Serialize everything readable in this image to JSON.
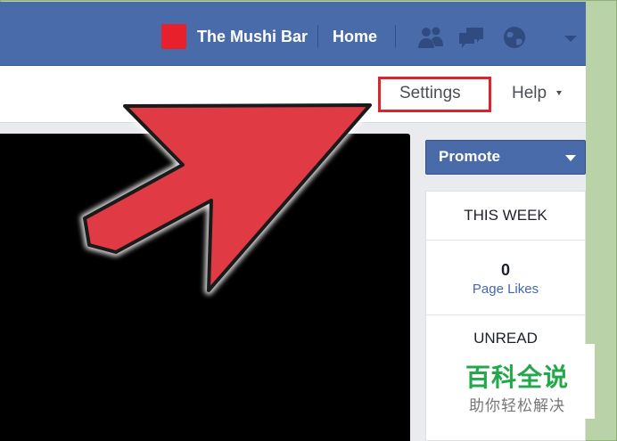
{
  "topbar": {
    "page_name": "The Mushi Bar",
    "home_label": "Home",
    "icons": [
      "friends-icon",
      "messages-icon",
      "globe-icon",
      "dropdown-caret-icon"
    ],
    "brand_color": "#4a6ba9"
  },
  "tabs": {
    "settings_label": "Settings",
    "help_label": "Help",
    "highlight_color": "#d9262e"
  },
  "sidebar": {
    "promote_label": "Promote",
    "this_week_title": "THIS WEEK",
    "page_likes_count": "0",
    "page_likes_label": "Page Likes",
    "unread_title": "UNREAD"
  },
  "overlay": {
    "arrow_color": "#e03a45",
    "watermark_title": "百科全说",
    "watermark_subtitle": "助你轻松解决"
  }
}
